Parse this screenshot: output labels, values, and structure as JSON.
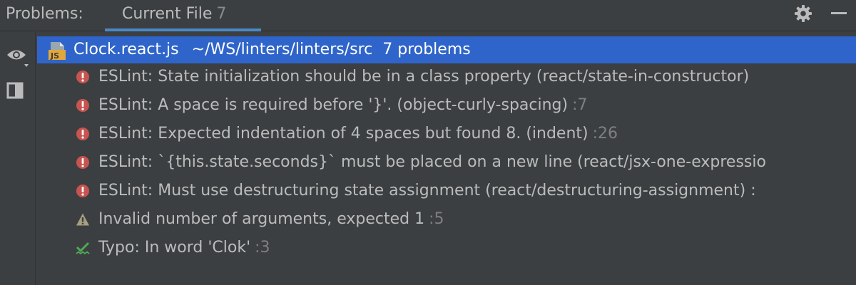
{
  "header": {
    "title": "Problems:",
    "tab_label": "Current File",
    "tab_count": "7"
  },
  "colors": {
    "accent": "#4a88c7",
    "selection": "#2f65ca",
    "error": "#c75450",
    "warning": "#a89f80",
    "typo": "#4fa857"
  },
  "file": {
    "name": "Clock.react.js",
    "path": "~/WS/linters/linters/src",
    "count": "7 problems",
    "icon": "js-file-icon"
  },
  "problems": [
    {
      "severity": "error",
      "icon": "error-icon",
      "message": "ESLint: State initialization should be in a class property (react/state-in-constructor)",
      "line": ""
    },
    {
      "severity": "error",
      "icon": "error-icon",
      "message": "ESLint: A space is required before '}'. (object-curly-spacing)",
      "line": ":7"
    },
    {
      "severity": "error",
      "icon": "error-icon",
      "message": "ESLint: Expected indentation of 4 spaces but found 8. (indent)",
      "line": ":26"
    },
    {
      "severity": "error",
      "icon": "error-icon",
      "message": "ESLint: `{this.state.seconds}` must be placed on a new line (react/jsx-one-expressio",
      "line": ""
    },
    {
      "severity": "error",
      "icon": "error-icon",
      "message": "ESLint: Must use destructuring state assignment (react/destructuring-assignment) :",
      "line": ""
    },
    {
      "severity": "warning",
      "icon": "warning-icon",
      "message": "Invalid number of arguments, expected 1",
      "line": ":5"
    },
    {
      "severity": "typo",
      "icon": "typo-icon",
      "message": "Typo: In word 'Clok'",
      "line": ":3"
    }
  ]
}
